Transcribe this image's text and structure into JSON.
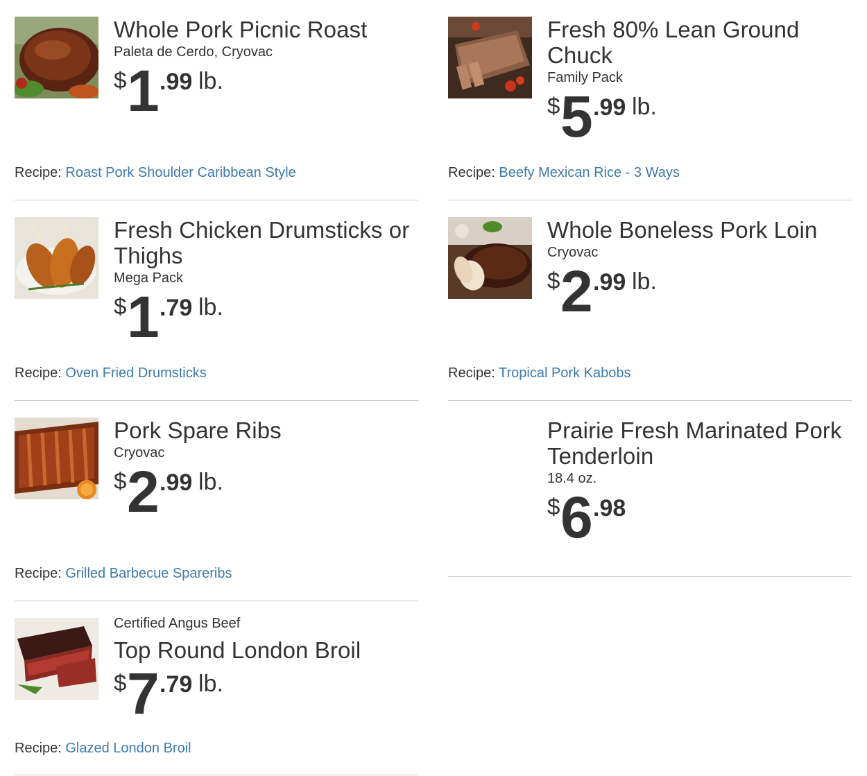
{
  "items": [
    {
      "title": "Whole Pork Picnic Roast",
      "subtitle": "Paleta de Cerdo, Cryovac",
      "price": {
        "dollar": "$",
        "whole": "1",
        "cents": ".99",
        "unit": "lb."
      },
      "recipe_label": "Recipe:",
      "recipe_link": "Roast Pork Shoulder Caribbean Style",
      "image": "roast-pork-image"
    },
    {
      "title": "Fresh 80% Lean Ground Chuck",
      "subtitle": "Family Pack",
      "price": {
        "dollar": "$",
        "whole": "5",
        "cents": ".99",
        "unit": "lb."
      },
      "recipe_label": "Recipe:",
      "recipe_link": "Beefy Mexican Rice - 3 Ways",
      "image": "meatloaf-image"
    },
    {
      "title": "Fresh Chicken Drumsticks or Thighs",
      "subtitle": "Mega Pack",
      "price": {
        "dollar": "$",
        "whole": "1",
        "cents": ".79",
        "unit": "lb."
      },
      "recipe_label": "Recipe:",
      "recipe_link": "Oven Fried Drumsticks",
      "image": "chicken-drumsticks-image"
    },
    {
      "title": "Whole Boneless Pork Loin",
      "subtitle": "Cryovac",
      "price": {
        "dollar": "$",
        "whole": "2",
        "cents": ".99",
        "unit": "lb."
      },
      "recipe_label": "Recipe:",
      "recipe_link": "Tropical Pork Kabobs",
      "image": "pork-loin-image"
    },
    {
      "title": "Pork Spare Ribs",
      "subtitle": "Cryovac",
      "price": {
        "dollar": "$",
        "whole": "2",
        "cents": ".99",
        "unit": "lb."
      },
      "recipe_label": "Recipe:",
      "recipe_link": "Grilled Barbecue Spareribs",
      "image": "spare-ribs-image"
    },
    {
      "title": "Prairie Fresh Marinated Pork Tenderloin",
      "subtitle": "18.4 oz.",
      "price": {
        "dollar": "$",
        "whole": "6",
        "cents": ".98",
        "unit": ""
      },
      "image": ""
    },
    {
      "brand": "Certified Angus Beef",
      "title": "Top Round London Broil",
      "price": {
        "dollar": "$",
        "whole": "7",
        "cents": ".79",
        "unit": "lb."
      },
      "recipe_label": "Recipe:",
      "recipe_link": "Glazed London Broil",
      "image": "london-broil-image"
    }
  ],
  "colors": {
    "link": "#3d7aab",
    "text": "#333333",
    "divider": "#cccccc"
  }
}
